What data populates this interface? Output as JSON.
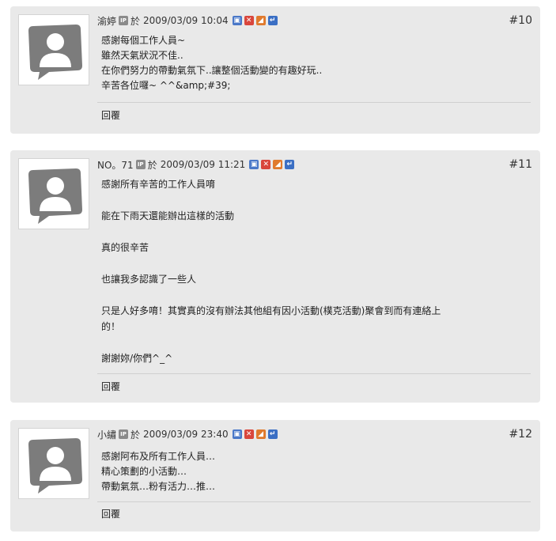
{
  "posts": [
    {
      "author": "渝婷",
      "ip_label": "IP",
      "at_label": "於",
      "datetime": "2009/03/09 10:04",
      "floor": "#10",
      "lines": [
        "感謝每個工作人員~",
        "雖然天氣狀況不佳..",
        "在你們努力的帶動氣氛下..讓整個活動變的有趣好玩..",
        "辛苦各位囉~ ^^&amp;#39;"
      ],
      "reply_label": "回覆"
    },
    {
      "author": "NO。71",
      "ip_label": "IP",
      "at_label": "於",
      "datetime": "2009/03/09 11:21",
      "floor": "#11",
      "lines": [
        "感謝所有辛苦的工作人員唷",
        "",
        "能在下雨天還能辦出這樣的活動",
        "",
        "真的很辛苦",
        "",
        "也讓我多認識了一些人",
        "",
        "只是人好多唷！其實真的沒有辦法其他組有因小活動(樸克活動)聚會到而有連絡上",
        "的！",
        "",
        "謝謝妳/你們^_^"
      ],
      "reply_label": "回覆"
    },
    {
      "author": "小繡",
      "ip_label": "IP",
      "at_label": "於",
      "datetime": "2009/03/09 23:40",
      "floor": "#12",
      "lines": [
        "感謝阿布及所有工作人員…",
        "精心策劃的小活動…",
        "帶動氣氛…粉有活力…推…"
      ],
      "reply_label": "回覆"
    }
  ],
  "icons": {
    "lock": "lock-icon",
    "delete": "delete-icon",
    "report": "report-icon",
    "quote_reply": "quote-reply-icon",
    "ip": "ip-icon",
    "avatar": "default-avatar-icon"
  },
  "colors": {
    "post_background": "#e9e9e9",
    "lock": "#4a78c8",
    "delete": "#d9463c",
    "report": "#e07a2d",
    "reply": "#3b6fc4"
  }
}
